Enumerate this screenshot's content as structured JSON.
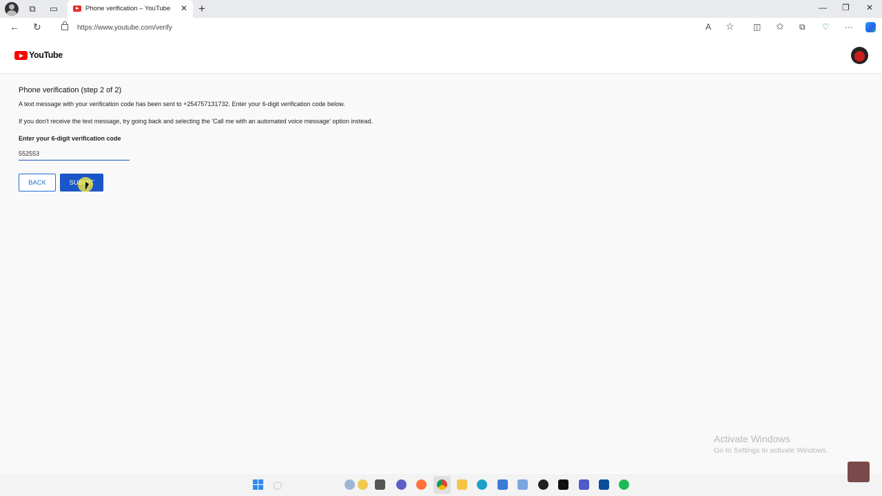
{
  "browser": {
    "tab": {
      "title": "Phone verification – YouTube",
      "close": "✕"
    },
    "new_tab": "+",
    "window_controls": {
      "minimize": "—",
      "restore": "❐",
      "close": "✕"
    },
    "nav": {
      "back": "←",
      "reload": "↻"
    },
    "url": "https://www.youtube.com/verify",
    "toolbar_icons": [
      "read-aloud-icon",
      "favorite-star-icon",
      "split-screen-icon",
      "favorites-icon",
      "collections-icon",
      "browser-essentials-icon",
      "more-icon",
      "copilot-icon"
    ],
    "toolbar_glyphs": {
      "read_aloud": "A",
      "favorite": "☆",
      "split": "◫",
      "favorites": "✩",
      "collections": "⧉",
      "essentials": "♡",
      "more": "···"
    }
  },
  "header": {
    "logo_text": "YouTube"
  },
  "verification": {
    "heading": "Phone verification (step 2 of 2)",
    "message": "A text message with your verification code has been sent to +254757131732. Enter your 6-digit verification code below.",
    "fallback": "If you don't receive the text message, try going back and selecting the 'Call me with an automated voice message' option instead.",
    "code_label": "Enter your 6-digit verification code",
    "code_value": "552553",
    "back_label": "BACK",
    "submit_label": "SUBMIT"
  },
  "watermark": {
    "line1": "Activate Windows",
    "line2": "Go to Settings to activate Windows."
  },
  "taskbar": {
    "apps": [
      "windows-start-icon",
      "search-icon",
      "widgets-icon",
      "file-explorer-icon",
      "chat-icon",
      "firefox-icon",
      "chrome-icon",
      "folder-icon",
      "edge-icon",
      "store-icon",
      "snipping-tool-icon",
      "obs-icon",
      "terminal-icon",
      "teams-icon",
      "app-icon",
      "spotify-icon"
    ],
    "colors": {
      "accent": "#1a56c6",
      "brand_red": "#ff0000"
    }
  }
}
